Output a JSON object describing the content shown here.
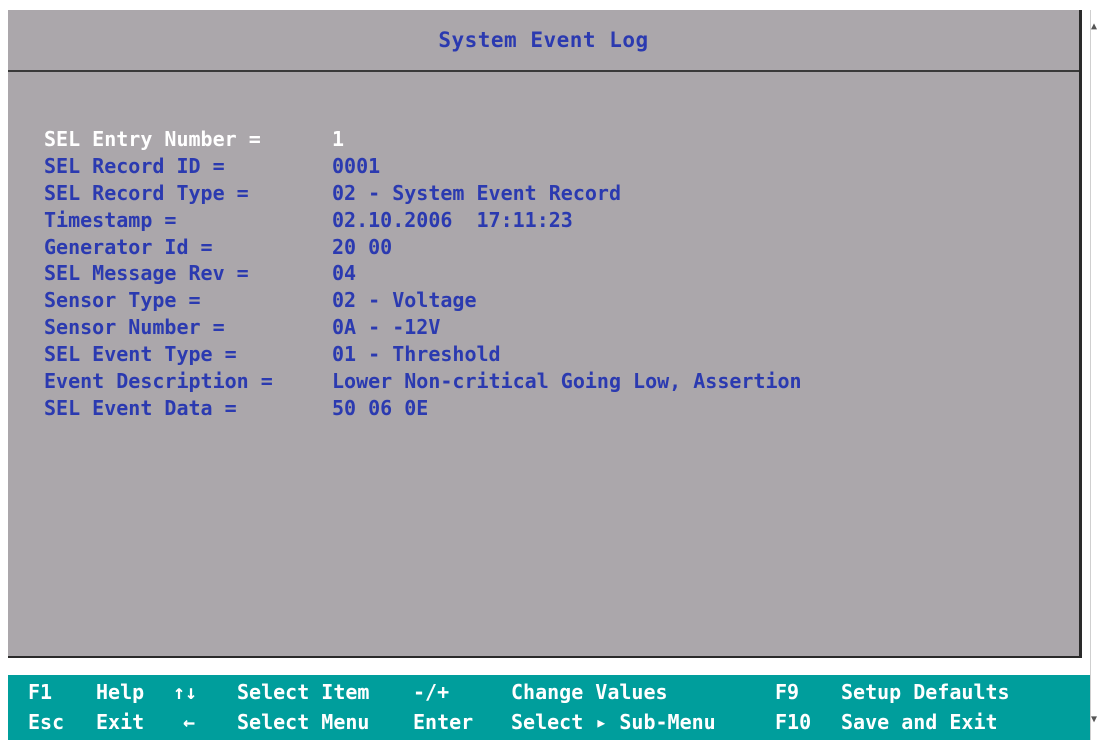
{
  "header": {
    "title": "System Event Log"
  },
  "fields": [
    {
      "label": "SEL Entry Number =",
      "value": "1"
    },
    {
      "label": "SEL Record ID =",
      "value": "0001"
    },
    {
      "label": "SEL Record Type =",
      "value": "02 - System Event Record"
    },
    {
      "label": "Timestamp =",
      "value": "02.10.2006  17:11:23"
    },
    {
      "label": "Generator Id =",
      "value": "20 00"
    },
    {
      "label": "SEL Message Rev =",
      "value": "04"
    },
    {
      "label": "Sensor Type =",
      "value": "02 - Voltage"
    },
    {
      "label": "Sensor Number =",
      "value": "0A - -12V"
    },
    {
      "label": "SEL Event Type =",
      "value": "01 - Threshold"
    },
    {
      "label": "Event Description =",
      "value": "Lower Non-critical Going Low, Assertion"
    },
    {
      "label": "SEL Event Data =",
      "value": "50 06 0E"
    }
  ],
  "help": {
    "row1": {
      "key1": "F1",
      "desc1": "Help",
      "key2": "↑↓",
      "desc2": "Select Item",
      "key3": "-/+",
      "desc3": "Change Values",
      "key4": "F9",
      "desc4": "Setup Defaults"
    },
    "row2": {
      "key1": "Esc",
      "desc1": "Exit",
      "key2": "←",
      "desc2": "Select Menu",
      "key3": "Enter",
      "desc3": "Select ▸ Sub-Menu",
      "key4": "F10",
      "desc4": "Save and Exit"
    }
  },
  "colors": {
    "panel_bg": "#aba7ab",
    "text_blue": "#2b3ab0",
    "selected_text": "#ffffff",
    "help_bar_bg": "#009e9c"
  }
}
